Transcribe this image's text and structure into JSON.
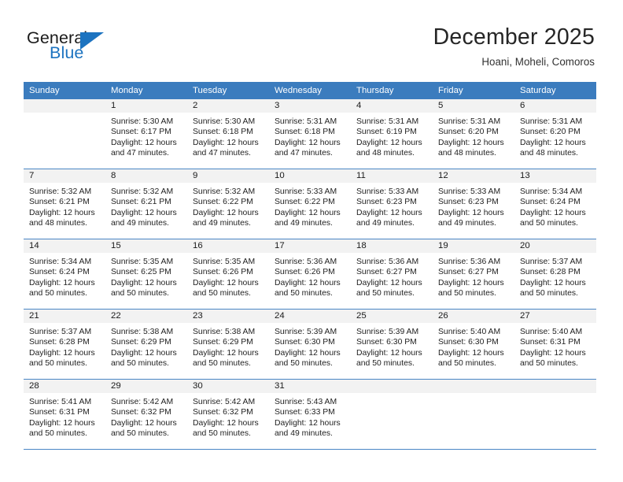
{
  "brand": {
    "name_part1": "General",
    "name_part2": "Blue",
    "flag_icon": "flag-triangle-icon",
    "accent_color": "#1c73c0"
  },
  "header": {
    "title": "December 2025",
    "subtitle": "Hoani, Moheli, Comoros"
  },
  "theme": {
    "header_row_bg": "#3b7cbe",
    "daynum_bg": "#f2f2f2",
    "grid_line": "#4a86c5",
    "text": "#1f1f1f"
  },
  "weekday_headers": [
    "Sunday",
    "Monday",
    "Tuesday",
    "Wednesday",
    "Thursday",
    "Friday",
    "Saturday"
  ],
  "weeks": [
    [
      {
        "day": "",
        "blank": true,
        "sunrise": "",
        "sunset": "",
        "daylight_line1": "",
        "daylight_line2": ""
      },
      {
        "day": "1",
        "sunrise": "Sunrise: 5:30 AM",
        "sunset": "Sunset: 6:17 PM",
        "daylight_line1": "Daylight: 12 hours",
        "daylight_line2": "and 47 minutes."
      },
      {
        "day": "2",
        "sunrise": "Sunrise: 5:30 AM",
        "sunset": "Sunset: 6:18 PM",
        "daylight_line1": "Daylight: 12 hours",
        "daylight_line2": "and 47 minutes."
      },
      {
        "day": "3",
        "sunrise": "Sunrise: 5:31 AM",
        "sunset": "Sunset: 6:18 PM",
        "daylight_line1": "Daylight: 12 hours",
        "daylight_line2": "and 47 minutes."
      },
      {
        "day": "4",
        "sunrise": "Sunrise: 5:31 AM",
        "sunset": "Sunset: 6:19 PM",
        "daylight_line1": "Daylight: 12 hours",
        "daylight_line2": "and 48 minutes."
      },
      {
        "day": "5",
        "sunrise": "Sunrise: 5:31 AM",
        "sunset": "Sunset: 6:20 PM",
        "daylight_line1": "Daylight: 12 hours",
        "daylight_line2": "and 48 minutes."
      },
      {
        "day": "6",
        "sunrise": "Sunrise: 5:31 AM",
        "sunset": "Sunset: 6:20 PM",
        "daylight_line1": "Daylight: 12 hours",
        "daylight_line2": "and 48 minutes."
      }
    ],
    [
      {
        "day": "7",
        "sunrise": "Sunrise: 5:32 AM",
        "sunset": "Sunset: 6:21 PM",
        "daylight_line1": "Daylight: 12 hours",
        "daylight_line2": "and 48 minutes."
      },
      {
        "day": "8",
        "sunrise": "Sunrise: 5:32 AM",
        "sunset": "Sunset: 6:21 PM",
        "daylight_line1": "Daylight: 12 hours",
        "daylight_line2": "and 49 minutes."
      },
      {
        "day": "9",
        "sunrise": "Sunrise: 5:32 AM",
        "sunset": "Sunset: 6:22 PM",
        "daylight_line1": "Daylight: 12 hours",
        "daylight_line2": "and 49 minutes."
      },
      {
        "day": "10",
        "sunrise": "Sunrise: 5:33 AM",
        "sunset": "Sunset: 6:22 PM",
        "daylight_line1": "Daylight: 12 hours",
        "daylight_line2": "and 49 minutes."
      },
      {
        "day": "11",
        "sunrise": "Sunrise: 5:33 AM",
        "sunset": "Sunset: 6:23 PM",
        "daylight_line1": "Daylight: 12 hours",
        "daylight_line2": "and 49 minutes."
      },
      {
        "day": "12",
        "sunrise": "Sunrise: 5:33 AM",
        "sunset": "Sunset: 6:23 PM",
        "daylight_line1": "Daylight: 12 hours",
        "daylight_line2": "and 49 minutes."
      },
      {
        "day": "13",
        "sunrise": "Sunrise: 5:34 AM",
        "sunset": "Sunset: 6:24 PM",
        "daylight_line1": "Daylight: 12 hours",
        "daylight_line2": "and 50 minutes."
      }
    ],
    [
      {
        "day": "14",
        "sunrise": "Sunrise: 5:34 AM",
        "sunset": "Sunset: 6:24 PM",
        "daylight_line1": "Daylight: 12 hours",
        "daylight_line2": "and 50 minutes."
      },
      {
        "day": "15",
        "sunrise": "Sunrise: 5:35 AM",
        "sunset": "Sunset: 6:25 PM",
        "daylight_line1": "Daylight: 12 hours",
        "daylight_line2": "and 50 minutes."
      },
      {
        "day": "16",
        "sunrise": "Sunrise: 5:35 AM",
        "sunset": "Sunset: 6:26 PM",
        "daylight_line1": "Daylight: 12 hours",
        "daylight_line2": "and 50 minutes."
      },
      {
        "day": "17",
        "sunrise": "Sunrise: 5:36 AM",
        "sunset": "Sunset: 6:26 PM",
        "daylight_line1": "Daylight: 12 hours",
        "daylight_line2": "and 50 minutes."
      },
      {
        "day": "18",
        "sunrise": "Sunrise: 5:36 AM",
        "sunset": "Sunset: 6:27 PM",
        "daylight_line1": "Daylight: 12 hours",
        "daylight_line2": "and 50 minutes."
      },
      {
        "day": "19",
        "sunrise": "Sunrise: 5:36 AM",
        "sunset": "Sunset: 6:27 PM",
        "daylight_line1": "Daylight: 12 hours",
        "daylight_line2": "and 50 minutes."
      },
      {
        "day": "20",
        "sunrise": "Sunrise: 5:37 AM",
        "sunset": "Sunset: 6:28 PM",
        "daylight_line1": "Daylight: 12 hours",
        "daylight_line2": "and 50 minutes."
      }
    ],
    [
      {
        "day": "21",
        "sunrise": "Sunrise: 5:37 AM",
        "sunset": "Sunset: 6:28 PM",
        "daylight_line1": "Daylight: 12 hours",
        "daylight_line2": "and 50 minutes."
      },
      {
        "day": "22",
        "sunrise": "Sunrise: 5:38 AM",
        "sunset": "Sunset: 6:29 PM",
        "daylight_line1": "Daylight: 12 hours",
        "daylight_line2": "and 50 minutes."
      },
      {
        "day": "23",
        "sunrise": "Sunrise: 5:38 AM",
        "sunset": "Sunset: 6:29 PM",
        "daylight_line1": "Daylight: 12 hours",
        "daylight_line2": "and 50 minutes."
      },
      {
        "day": "24",
        "sunrise": "Sunrise: 5:39 AM",
        "sunset": "Sunset: 6:30 PM",
        "daylight_line1": "Daylight: 12 hours",
        "daylight_line2": "and 50 minutes."
      },
      {
        "day": "25",
        "sunrise": "Sunrise: 5:39 AM",
        "sunset": "Sunset: 6:30 PM",
        "daylight_line1": "Daylight: 12 hours",
        "daylight_line2": "and 50 minutes."
      },
      {
        "day": "26",
        "sunrise": "Sunrise: 5:40 AM",
        "sunset": "Sunset: 6:30 PM",
        "daylight_line1": "Daylight: 12 hours",
        "daylight_line2": "and 50 minutes."
      },
      {
        "day": "27",
        "sunrise": "Sunrise: 5:40 AM",
        "sunset": "Sunset: 6:31 PM",
        "daylight_line1": "Daylight: 12 hours",
        "daylight_line2": "and 50 minutes."
      }
    ],
    [
      {
        "day": "28",
        "sunrise": "Sunrise: 5:41 AM",
        "sunset": "Sunset: 6:31 PM",
        "daylight_line1": "Daylight: 12 hours",
        "daylight_line2": "and 50 minutes."
      },
      {
        "day": "29",
        "sunrise": "Sunrise: 5:42 AM",
        "sunset": "Sunset: 6:32 PM",
        "daylight_line1": "Daylight: 12 hours",
        "daylight_line2": "and 50 minutes."
      },
      {
        "day": "30",
        "sunrise": "Sunrise: 5:42 AM",
        "sunset": "Sunset: 6:32 PM",
        "daylight_line1": "Daylight: 12 hours",
        "daylight_line2": "and 50 minutes."
      },
      {
        "day": "31",
        "sunrise": "Sunrise: 5:43 AM",
        "sunset": "Sunset: 6:33 PM",
        "daylight_line1": "Daylight: 12 hours",
        "daylight_line2": "and 49 minutes."
      },
      {
        "day": "",
        "blank": true,
        "sunrise": "",
        "sunset": "",
        "daylight_line1": "",
        "daylight_line2": ""
      },
      {
        "day": "",
        "blank": true,
        "sunrise": "",
        "sunset": "",
        "daylight_line1": "",
        "daylight_line2": ""
      },
      {
        "day": "",
        "blank": true,
        "sunrise": "",
        "sunset": "",
        "daylight_line1": "",
        "daylight_line2": ""
      }
    ]
  ]
}
